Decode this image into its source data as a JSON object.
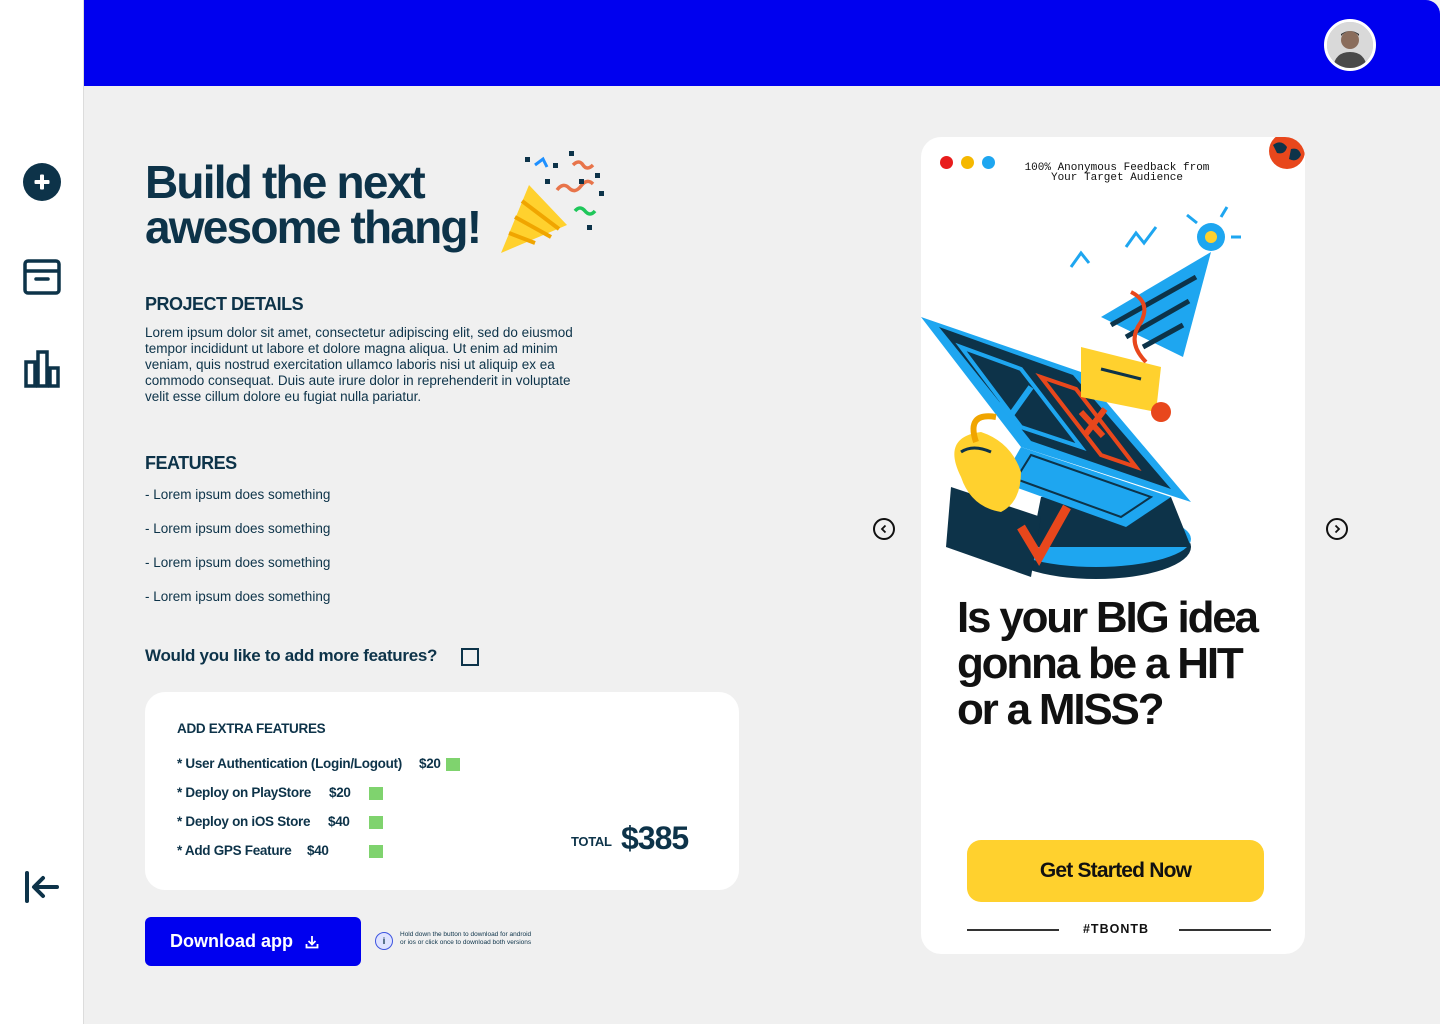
{
  "sidebar": {
    "items": [
      {
        "icon": "add-circle-icon"
      },
      {
        "icon": "archive-icon"
      },
      {
        "icon": "bar-chart-icon"
      },
      {
        "icon": "logout-icon"
      }
    ]
  },
  "header": {
    "avatar_icon": "user-avatar",
    "bar_color": "#0000ef"
  },
  "hero": {
    "title": "Build the next awesome thang!",
    "emoji_icon": "party-popper-icon"
  },
  "project": {
    "heading": "PROJECT DETAILS",
    "description": "Lorem ipsum dolor sit amet, consectetur adipiscing elit, sed do eiusmod tempor incididunt ut labore et dolore magna aliqua. Ut enim ad minim veniam, quis nostrud exercitation ullamco laboris nisi ut aliquip ex ea commodo consequat. Duis aute irure dolor in reprehenderit in voluptate velit esse cillum dolore eu fugiat nulla pariatur."
  },
  "features": {
    "heading": "FEATURES",
    "items": [
      "- Lorem ipsum does something",
      "- Lorem ipsum does something",
      "- Lorem ipsum does something",
      "- Lorem ipsum does something"
    ]
  },
  "more_features": {
    "question": "Would you like to add more features?",
    "checked": false
  },
  "extras": {
    "heading": "ADD EXTRA FEATURES",
    "items": [
      {
        "label": "* User Authentication (Login/Logout)",
        "price": "$20"
      },
      {
        "label": "* Deploy on PlayStore",
        "price": "$20"
      },
      {
        "label": "* Deploy on iOS Store",
        "price": "$40"
      },
      {
        "label": "* Add GPS Feature",
        "price": "$40"
      }
    ],
    "total_label": "TOTAL",
    "total_value": "$385",
    "checkbox_color": "#7fd36e"
  },
  "download": {
    "label": "Download app",
    "icon": "download-icon",
    "info_icon": "info-icon",
    "hint": "Hold down the button to download for android or ios or click once to download both versions"
  },
  "carousel": {
    "prev_icon": "chevron-left-icon",
    "next_icon": "chevron-right-icon"
  },
  "promo": {
    "window_dots": [
      "#e81c1c",
      "#f5b800",
      "#1ea6f0"
    ],
    "caption": "100% Anonymous Feedback from Your Target Audience",
    "headline": "Is your BIG idea gonna be a HIT or a MISS?",
    "cta_label": "Get Started Now",
    "hashtag": "#TBONTB",
    "accent_yellow": "#ffd12e"
  }
}
